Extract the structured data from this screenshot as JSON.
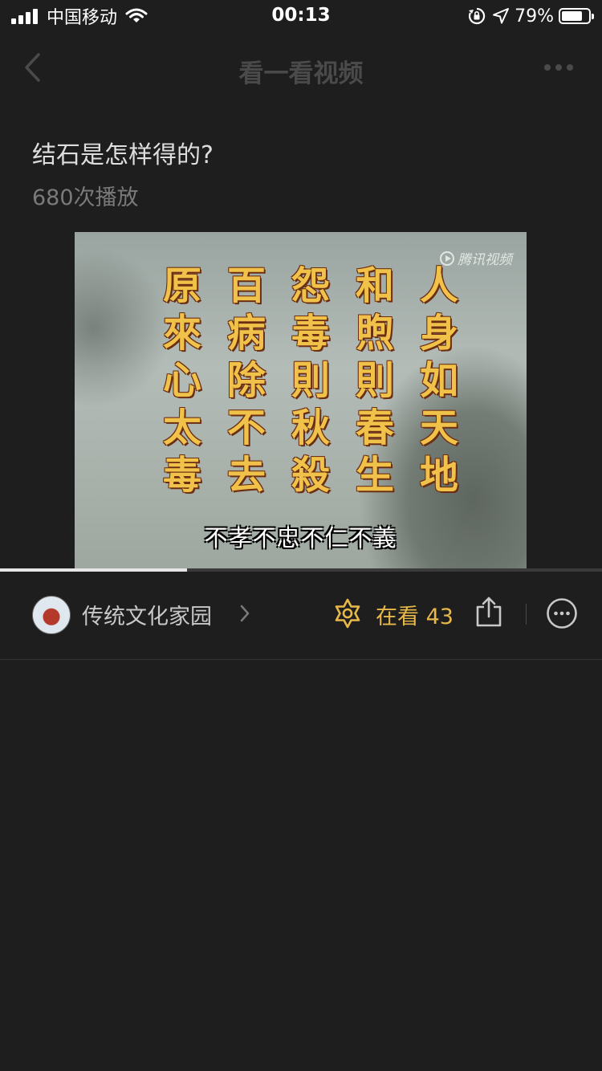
{
  "status_bar": {
    "carrier": "中国移动",
    "time": "00:13",
    "battery_percent": "79%",
    "battery_level": 0.79,
    "icons": [
      "signal-icon",
      "wifi-icon",
      "orientation-lock-icon",
      "location-icon",
      "battery-icon"
    ]
  },
  "nav": {
    "title": "看一看视频",
    "icons": [
      "back-chevron-icon",
      "more-dots-icon"
    ]
  },
  "video": {
    "title": "结石是怎样得的?",
    "play_count": "680次播放",
    "watermark": "腾讯视频",
    "frame_text_rows": [
      [
        "原",
        "百",
        "怨",
        "和",
        "人"
      ],
      [
        "來",
        "病",
        "毒",
        "煦",
        "身"
      ],
      [
        "心",
        "除",
        "則",
        "則",
        "如"
      ],
      [
        "太",
        "不",
        "秋",
        "春",
        "天"
      ],
      [
        "毒",
        "去",
        "殺",
        "生",
        "地"
      ]
    ],
    "subtitle": "不孝不忠不仁不義",
    "progress": 0.31
  },
  "actions": {
    "account_name": "传统文化家园",
    "wow_label": "在看 43",
    "icons": [
      "avatar",
      "chevron-right-icon",
      "wow-icon",
      "share-icon",
      "more-circle-icon"
    ]
  },
  "colors": {
    "background": "#1e1e1e",
    "wow_accent": "#e8b84a",
    "nav_title": "#4a4a4a"
  }
}
